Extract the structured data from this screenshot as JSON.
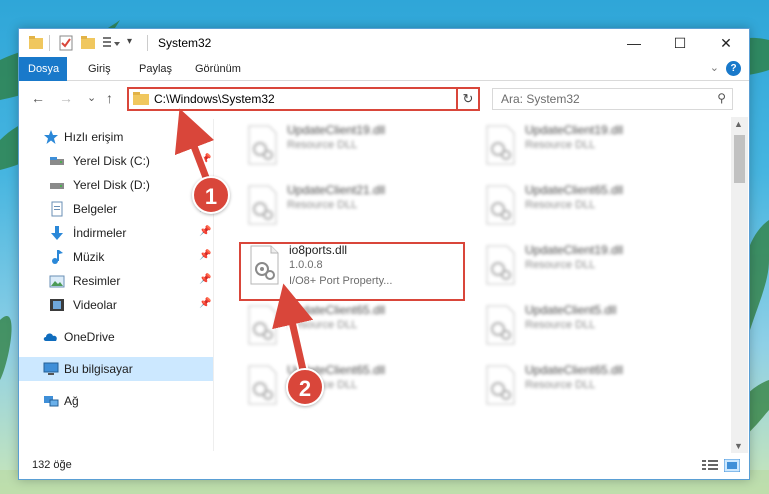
{
  "window": {
    "title": "System32",
    "controls": {
      "minimize": "—",
      "maximize": "☐",
      "close": "✕"
    }
  },
  "ribbon": {
    "tabs": [
      {
        "label": "Dosya",
        "active": true
      },
      {
        "label": "Giriş",
        "active": false
      },
      {
        "label": "Paylaş",
        "active": false
      },
      {
        "label": "Görünüm",
        "active": false
      }
    ],
    "help_label": "?"
  },
  "navbar": {
    "back": "←",
    "forward": "→",
    "recent": "⌄",
    "up": "↑",
    "address_path": "C:\\Windows\\System32",
    "refresh": "↻",
    "search_placeholder": "Ara: System32"
  },
  "sidebar": {
    "items": [
      {
        "label": "Hızlı erişim",
        "icon": "star-icon",
        "pinned": false
      },
      {
        "label": "Yerel Disk (C:)",
        "icon": "drive-icon",
        "pinned": true
      },
      {
        "label": "Yerel Disk (D:)",
        "icon": "drive-icon",
        "pinned": true
      },
      {
        "label": "Belgeler",
        "icon": "document-icon",
        "pinned": true
      },
      {
        "label": "İndirmeler",
        "icon": "download-icon",
        "pinned": true
      },
      {
        "label": "Müzik",
        "icon": "music-icon",
        "pinned": true
      },
      {
        "label": "Resimler",
        "icon": "pictures-icon",
        "pinned": true
      },
      {
        "label": "Videolar",
        "icon": "video-icon",
        "pinned": true
      },
      {
        "label": "OneDrive",
        "icon": "cloud-icon",
        "pinned": false
      },
      {
        "label": "Bu bilgisayar",
        "icon": "computer-icon",
        "pinned": false,
        "selected": true
      },
      {
        "label": "Ağ",
        "icon": "network-icon",
        "pinned": false
      }
    ]
  },
  "files": [
    {
      "name": "UpdateClient19.dll",
      "line2": "Resource DLL",
      "line3": "",
      "blurred": true
    },
    {
      "name": "UpdateClient19.dll",
      "line2": "Resource DLL",
      "line3": "",
      "blurred": true
    },
    {
      "name": "UpdateClient21.dll",
      "line2": "Resource DLL",
      "line3": "",
      "blurred": true
    },
    {
      "name": "UpdateClient65.dll",
      "line2": "Resource DLL",
      "line3": "",
      "blurred": true
    },
    {
      "name": "io8ports.dll",
      "line2": "1.0.0.8",
      "line3": "I/O8+ Port Property...",
      "blurred": false
    },
    {
      "name": "UpdateClient19.dll",
      "line2": "Resource DLL",
      "line3": "",
      "blurred": true
    },
    {
      "name": "UpdateClient65.dll",
      "line2": "Resource DLL",
      "line3": "",
      "blurred": true
    },
    {
      "name": "UpdateClient5.dll",
      "line2": "Resource DLL",
      "line3": "",
      "blurred": true
    },
    {
      "name": "UpdateClient65.dll",
      "line2": "Resource DLL",
      "line3": "",
      "blurred": true
    },
    {
      "name": "UpdateClient65.dll",
      "line2": "Resource DLL",
      "line3": "",
      "blurred": true
    }
  ],
  "status": {
    "item_count": "132 öğe"
  },
  "callouts": {
    "first": "1",
    "second": "2"
  },
  "colors": {
    "accent": "#1979ca",
    "highlight": "#d9463a",
    "selected_bg": "#cce8ff"
  }
}
